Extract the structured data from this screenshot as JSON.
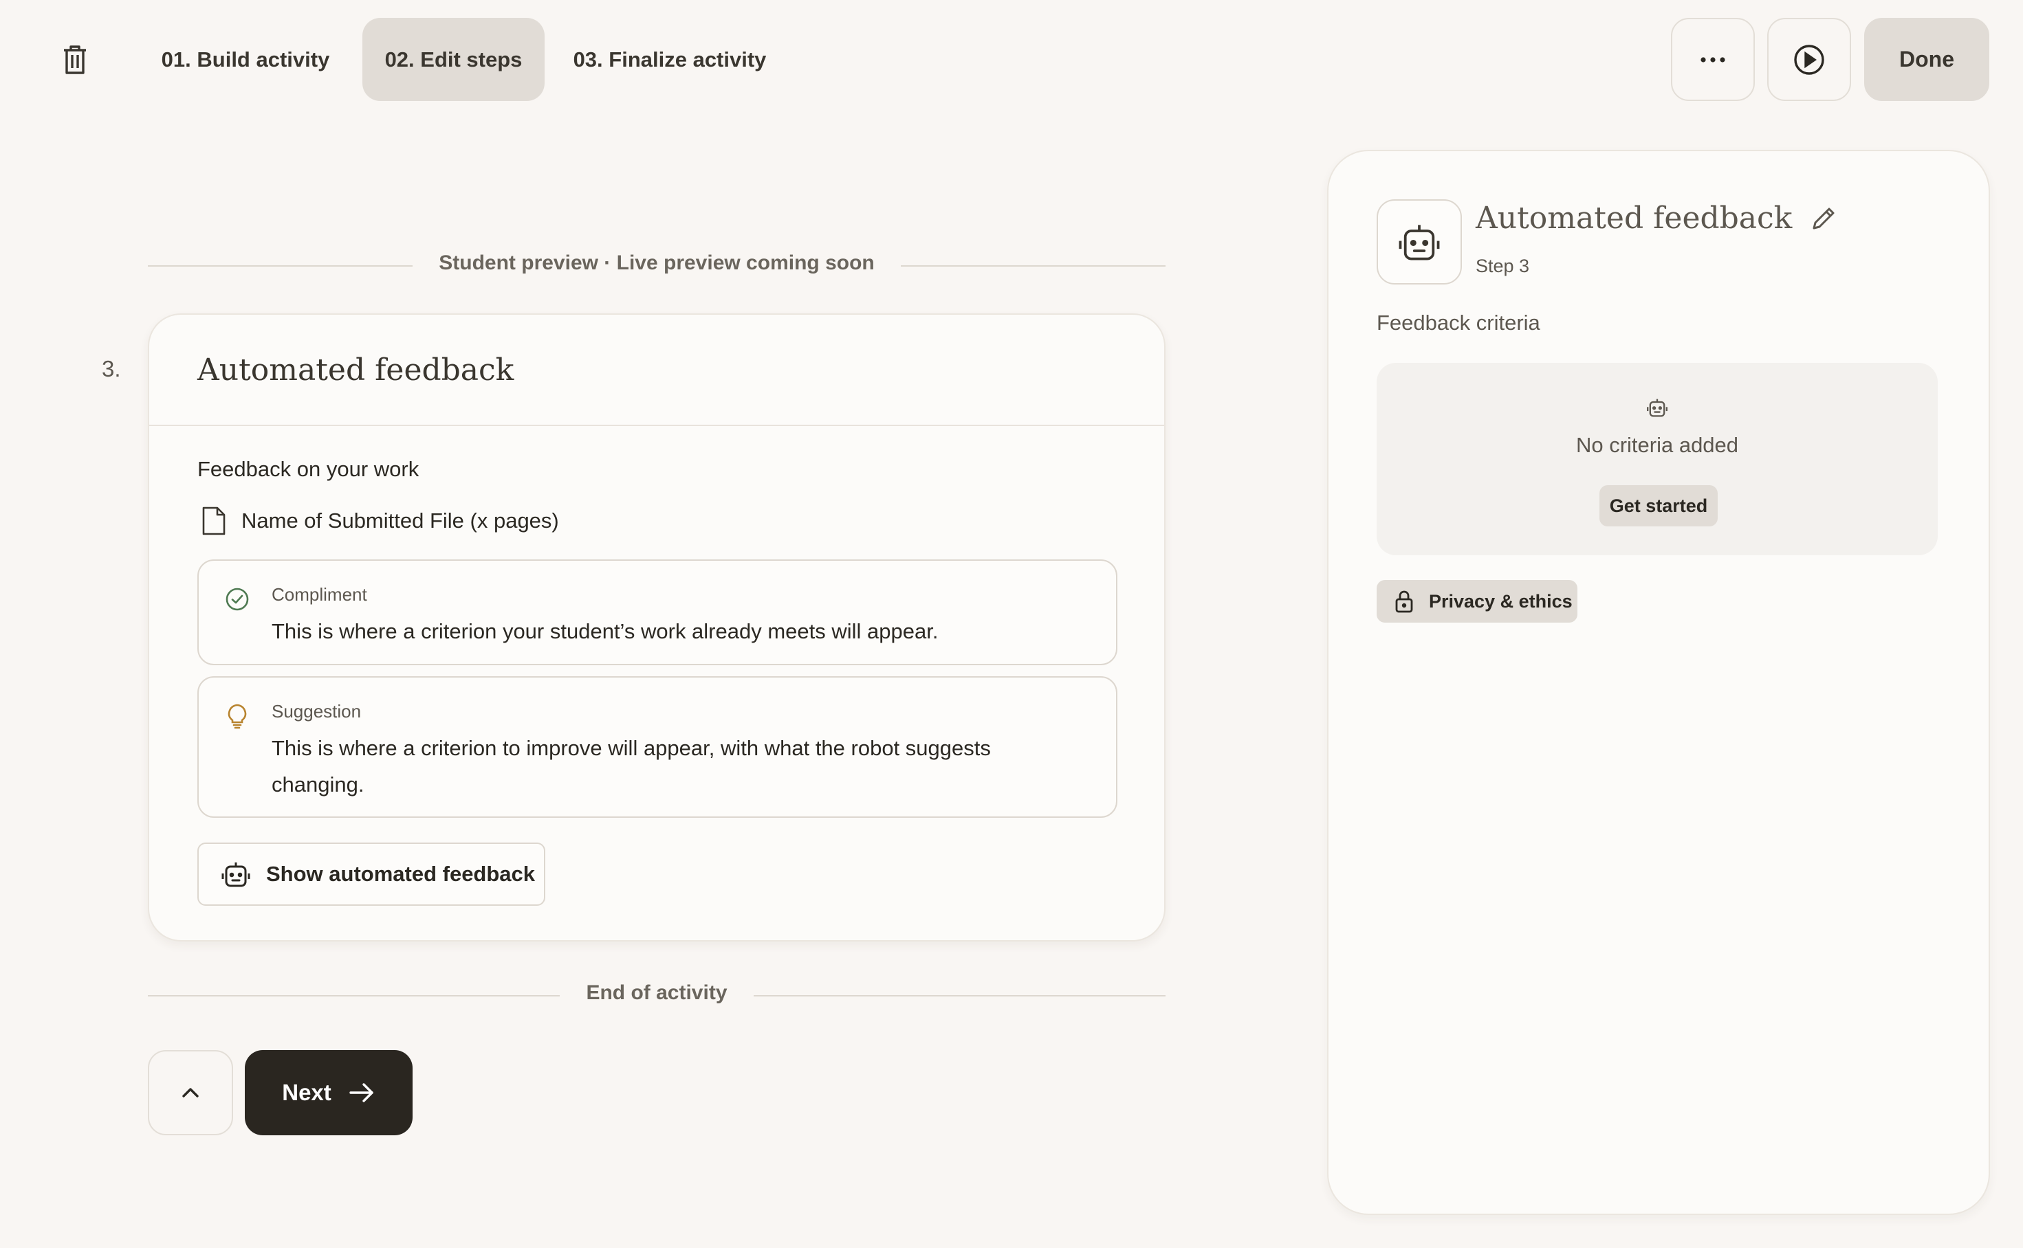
{
  "topbar": {
    "tabs": [
      {
        "label": "01. Build activity"
      },
      {
        "label": "02. Edit steps",
        "active": true
      },
      {
        "label": "03. Finalize activity"
      }
    ],
    "more_icon": "more-horizontal-icon",
    "play_icon": "play-circle-icon",
    "done_label": "Done",
    "delete_icon": "trash-icon"
  },
  "preview": {
    "divider_label": "Student preview · Live preview coming soon",
    "step_number": "3.",
    "card_title": "Automated feedback",
    "feedback_heading": "Feedback on your work",
    "file_name": "Name of Submitted File (x pages)",
    "compliment": {
      "kind": "Compliment",
      "text": "This is where a criterion your student’s work already meets will appear."
    },
    "suggestion": {
      "kind": "Suggestion",
      "text": "This is where a criterion to improve will appear, with what the robot suggests changing."
    },
    "show_button_label": "Show automated feedback",
    "end_label": "End of activity"
  },
  "nav": {
    "next_label": "Next"
  },
  "panel": {
    "title": "Automated feedback",
    "step_label": "Step 3",
    "criteria_label": "Feedback criteria",
    "empty_text": "No criteria added",
    "get_started_label": "Get started",
    "privacy_label": "Privacy & ethics"
  },
  "colors": {
    "background": "#f9f6f3",
    "active_tab": "#e1dcd6",
    "primary_button": "#2a2620",
    "compliment_icon": "#4f7a52",
    "suggestion_icon": "#b8842f"
  }
}
